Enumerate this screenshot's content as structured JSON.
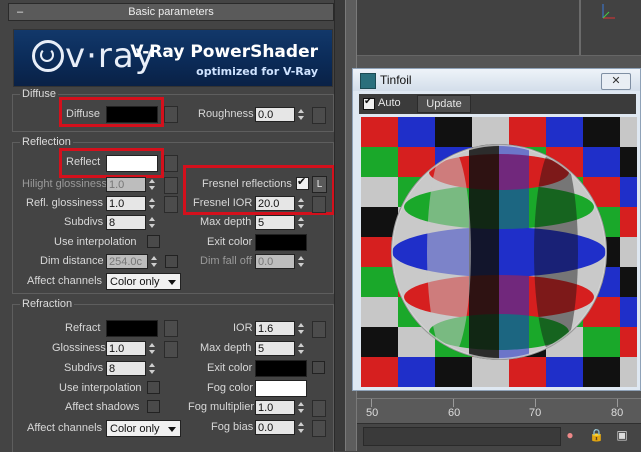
{
  "rollout": {
    "collapse": "–",
    "title": "Basic parameters"
  },
  "banner": {
    "logo": "v·ray",
    "title": "V-Ray PowerShader",
    "subtitle": "optimized for V-Ray"
  },
  "diffuse": {
    "group": "Diffuse",
    "diffuse_label": "Diffuse",
    "roughness_label": "Roughness",
    "roughness_value": "0.0"
  },
  "reflection": {
    "group": "Reflection",
    "reflect_label": "Reflect",
    "hilight_label": "Hilight glossiness",
    "hilight_value": "1.0",
    "refl_gloss_label": "Refl. glossiness",
    "refl_gloss_value": "1.0",
    "subdivs_label": "Subdivs",
    "subdivs_value": "8",
    "use_interp_label": "Use interpolation",
    "dim_distance_label": "Dim distance",
    "dim_distance_value": "254.0c",
    "affect_channels_label": "Affect channels",
    "affect_channels_value": "Color only",
    "fresnel_label": "Fresnel reflections",
    "fresnel_lock": "L",
    "fresnel_ior_label": "Fresnel IOR",
    "fresnel_ior_value": "20.0",
    "max_depth_label": "Max depth",
    "max_depth_value": "5",
    "exit_color_label": "Exit color",
    "dim_falloff_label": "Dim fall off",
    "dim_falloff_value": "0.0"
  },
  "refraction": {
    "group": "Refraction",
    "refract_label": "Refract",
    "ior_label": "IOR",
    "ior_value": "1.6",
    "gloss_label": "Glossiness",
    "gloss_value": "1.0",
    "max_depth_label": "Max depth",
    "max_depth_value": "5",
    "subdivs_label": "Subdivs",
    "subdivs_value": "8",
    "exit_color_label": "Exit color",
    "use_interp_label": "Use interpolation",
    "fog_color_label": "Fog color",
    "affect_shadows_label": "Affect shadows",
    "fog_mult_label": "Fog multiplier",
    "fog_mult_value": "1.0",
    "affect_channels_label": "Affect channels",
    "affect_channels_value": "Color only",
    "fog_bias_label": "Fog bias",
    "fog_bias_value": "0.0"
  },
  "colors": {
    "diffuse_swatch": "#000000",
    "reflect_swatch": "#ffffff",
    "exit_color_swatch": "#000000",
    "refract_swatch": "#000000",
    "fog_color_swatch": "#ffffff",
    "highlight_box": "#d4101c"
  },
  "tinfoil": {
    "title": "Tinfoil",
    "close": "✕",
    "auto_label": "Auto",
    "update_label": "Update"
  },
  "timeline": {
    "ticks": [
      "50",
      "60",
      "70",
      "80"
    ]
  }
}
